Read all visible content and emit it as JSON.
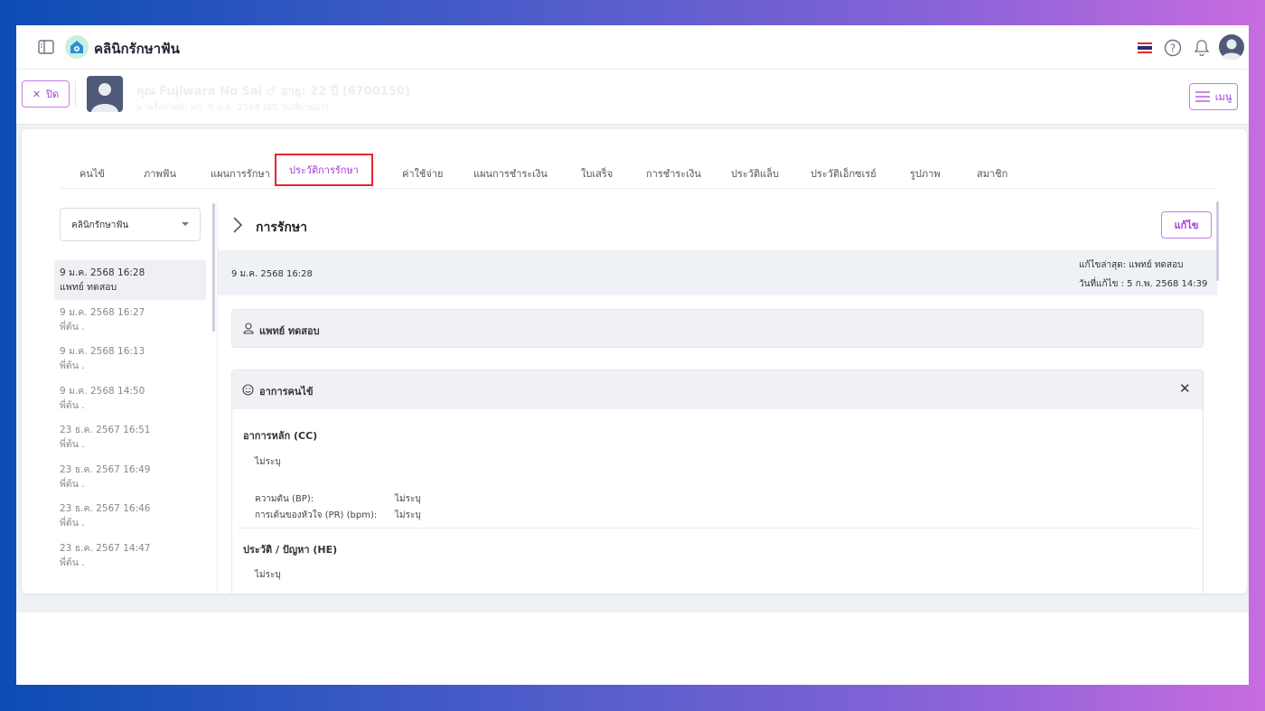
{
  "header": {
    "brand": "คลินิกรักษาฟัน",
    "icons": [
      "sidebar-toggle-icon",
      "clinic-logo-icon",
      "thai-flag-icon",
      "help-icon",
      "bell-icon",
      "avatar-icon"
    ]
  },
  "patient": {
    "close_label": "ปิด",
    "name": "คุณ Fujiwara No Sai",
    "gender": "♂",
    "age": "อายุ: 22 ปี",
    "hn": "(6700150)",
    "last_visit": "มาครั้งล่าสุด: พฤ. 9 ม.ค. 2568 (85 วันที่ผ่านมา)",
    "menu_label": "เมนู"
  },
  "tabs": [
    {
      "label": "คนไข้"
    },
    {
      "label": "ภาพฟัน"
    },
    {
      "label": "แผนการรักษา"
    },
    {
      "label": "ประวัติการรักษา",
      "active": true
    },
    {
      "label": "ค่าใช้จ่าย"
    },
    {
      "label": "แผนการชำระเงิน"
    },
    {
      "label": "ใบเสร็จ"
    },
    {
      "label": "การชำระเงิน"
    },
    {
      "label": "ประวัติแล็บ"
    },
    {
      "label": "ประวัติเอ็กซเรย์"
    },
    {
      "label": "รูปภาพ"
    },
    {
      "label": "สมาชิก"
    }
  ],
  "clinic_select": {
    "value": "คลินิกรักษาฟัน"
  },
  "history": [
    {
      "date": "9 ม.ค. 2568 16:28",
      "by": "แพทย์ ทดสอบ",
      "active": true
    },
    {
      "date": "9 ม.ค. 2568 16:27",
      "by": "พี่ต้น ."
    },
    {
      "date": "9 ม.ค. 2568 16:13",
      "by": "พี่ต้น ."
    },
    {
      "date": "9 ม.ค. 2568 14:50",
      "by": "พี่ต้น ."
    },
    {
      "date": "23 ธ.ค. 2567 16:51",
      "by": "พี่ต้น ."
    },
    {
      "date": "23 ธ.ค. 2567 16:49",
      "by": "พี่ต้น ."
    },
    {
      "date": "23 ธ.ค. 2567 16:46",
      "by": "พี่ต้น ."
    },
    {
      "date": "23 ธ.ค. 2567 14:47",
      "by": "พี่ต้น ."
    }
  ],
  "detail": {
    "title": "การรักษา",
    "edit_label": "แก้ไข",
    "date": "9 ม.ค. 2568 16:28",
    "last_edited_by": "แก้ไขล่าสุด: แพทย์ ทดสอบ",
    "edited_at": "วันที่แก้ไข : 5 ก.พ. 2568 14:39",
    "doctor": "แพทย์ ทดสอบ",
    "symptoms": {
      "title": "อาการคนไข้",
      "cc_title": "อาการหลัก (CC)",
      "cc_value": "ไม่ระบุ",
      "bp_label": "ความดัน (BP):",
      "bp_value": "ไม่ระบุ",
      "pr_label": "การเต้นของหัวใจ (PR) (bpm):",
      "pr_value": "ไม่ระบุ",
      "he_title": "ประวัติ / ปัญหา (HE)",
      "he_value": "ไม่ระบุ"
    }
  },
  "colors": {
    "accent": "#a23fd6",
    "highlight": "#e8262d"
  }
}
